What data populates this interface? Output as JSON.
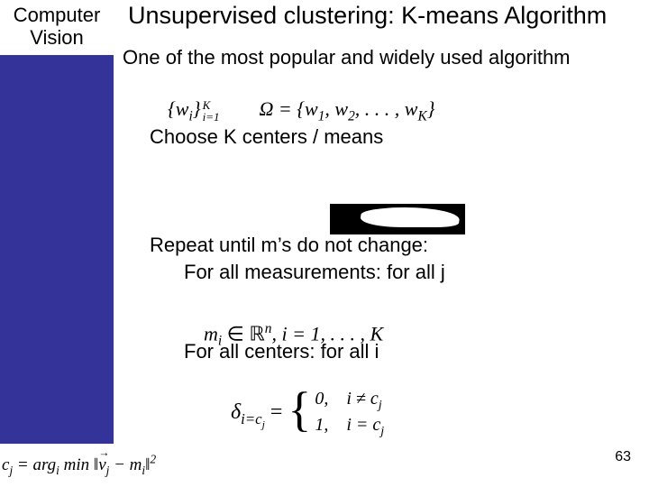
{
  "sidebar": {
    "title_line1": "Computer",
    "title_line2": "Vision"
  },
  "slide": {
    "title": "Unsupervised clustering: K-means Algorithm",
    "intro": "One of the most popular and widely used algorithm",
    "choose": "Choose K centers / means",
    "repeat": "Repeat until m’s do not change:",
    "for_meas": "For all measurements: for all j",
    "for_cent": "For all centers: for all i",
    "page_number": "63"
  },
  "math": {
    "wset_lhs": "{w",
    "wset_sub": "i",
    "wset_rhs": "}",
    "wset_sup": "K",
    "wset_from": "i=1",
    "omega_eq": "Ω = {w",
    "omega_1": "1",
    "omega_mid": ", w",
    "omega_2": "2",
    "omega_dots": ", . . . , w",
    "omega_K": "K",
    "omega_close": "}",
    "mi_lhs": "m",
    "mi_sub": "i",
    "mi_in": " ∈ ",
    "mi_Rn": "ℝ",
    "mi_n": "n",
    "mi_range": ",  i = 1, . . . , K",
    "delta_sym": "δ",
    "delta_sub": "i=c",
    "delta_sub_j": "j",
    "delta_eq": " = ",
    "case0": "0,",
    "case0_cond_l": "i ≠ c",
    "case0_cond_r": "j",
    "case1": "1,",
    "case1_cond_l": "i = c",
    "case1_cond_r": "j",
    "corner_cj": "c",
    "corner_j": "j",
    "corner_argmin": " = arg",
    "corner_i": "i",
    "corner_min": " min ",
    "corner_vj": "v",
    "corner_jj": "j",
    "corner_minus": " − m",
    "corner_ii": "i",
    "corner_sq": "2",
    "corner_bars_l": "‖",
    "corner_bars_r": "‖"
  }
}
